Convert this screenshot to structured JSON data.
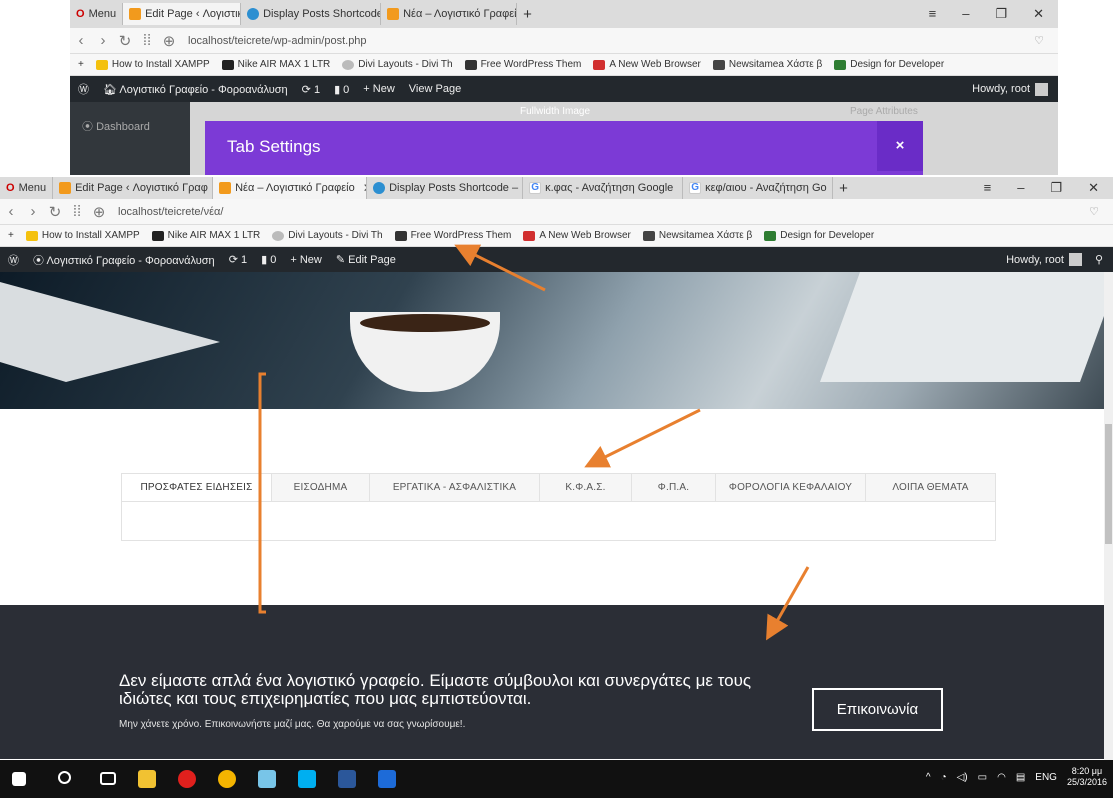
{
  "back_window": {
    "tabs": [
      {
        "label": "Menu",
        "kind": "menu"
      },
      {
        "label": "Edit Page ‹ Λογιστικό Γραφ",
        "icon": "orange",
        "active": true
      },
      {
        "label": "Display Posts Shortcode –",
        "icon": "wp"
      },
      {
        "label": "Νέα – Λογιστικό Γραφείο",
        "icon": "orange"
      }
    ],
    "url": "localhost/teicrete/wp-admin/post.php",
    "bookmarks": [
      "How to Install XAMPP",
      "Nike AIR MAX 1 LTR",
      "Divi Layouts - Divi Th",
      "Free WordPress Them",
      "A New Web Browser",
      "Newsitamea Χάστε β",
      "Design for Developer"
    ],
    "adminbar": {
      "site": "Λογιστικό Γραφείο - Φοροανάλυση",
      "updates": "1",
      "comments": "0",
      "new": "New",
      "view": "View Page",
      "howdy": "Howdy, root"
    },
    "sidebar_item": "Dashboard",
    "ghost_labels": {
      "fullwidth": "Fullwidth Image",
      "page_attributes": "Page Attributes"
    },
    "modal_title": "Tab Settings",
    "modal_close": "×"
  },
  "front_window": {
    "tabs": [
      {
        "label": "Menu",
        "kind": "menu"
      },
      {
        "label": "Edit Page ‹ Λογιστικό Γραφ",
        "icon": "orange"
      },
      {
        "label": "Νέα – Λογιστικό Γραφείο",
        "icon": "orange",
        "active": true
      },
      {
        "label": "Display Posts Shortcode –",
        "icon": "wp"
      },
      {
        "label": "κ.φας - Αναζήτηση Google",
        "icon": "g"
      },
      {
        "label": "κεφ/αιου - Αναζήτηση Go",
        "icon": "g"
      }
    ],
    "url": "localhost/teicrete/νέα/",
    "bookmarks": [
      "How to Install XAMPP",
      "Nike AIR MAX 1 LTR",
      "Divi Layouts - Divi Th",
      "Free WordPress Them",
      "A New Web Browser",
      "Newsitamea Χάστε β",
      "Design for Developer"
    ],
    "adminbar": {
      "site": "Λογιστικό Γραφείο - Φοροανάλυση",
      "updates": "1",
      "comments": "0",
      "new": "New",
      "edit": "Edit Page",
      "howdy": "Howdy, root"
    },
    "content_tabs": [
      "ΠΡΟΣΦΑΤΕΣ ΕΙΔΗΣΕΙΣ",
      "ΕΙΣΟΔΗΜΑ",
      "ΕΡΓΑΤΙΚΑ - ΑΣΦΑΛΙΣΤΙΚΑ",
      "Κ.Φ.Α.Σ.",
      "Φ.Π.Α.",
      "ΦΟΡΟΛΟΓΙΑ ΚΕΦΑΛΑΙΟΥ",
      "ΛΟΙΠΑ ΘΕΜΑΤΑ"
    ],
    "cta": {
      "headline": "Δεν είμαστε απλά ένα λογιστικό γραφείο. Είμαστε σύμβουλοι και συνεργάτες με τους ιδιώτες και τους επιχειρηματίες που μας εμπιστεύονται.",
      "sub": "Μην χάνετε χρόνο. Επικοινωνήστε μαζί μας. Θα χαρούμε να σας γνωρίσουμε!.",
      "button": "Επικοινωνία"
    }
  },
  "taskbar": {
    "apps": [
      "start-icon",
      "search-icon",
      "task-view-icon",
      "file-explorer-icon",
      "opera-icon",
      "chrome-icon",
      "folder-icon",
      "skype-icon",
      "word-icon",
      "brackets-icon"
    ],
    "lang": "ENG",
    "time": "8:20 μμ",
    "date": "25/3/2016"
  },
  "colors": {
    "purple": "#7c3ad6",
    "admin_bar": "#23282d",
    "cta_bg": "#2b2e36",
    "arrow": "#e8802f"
  }
}
